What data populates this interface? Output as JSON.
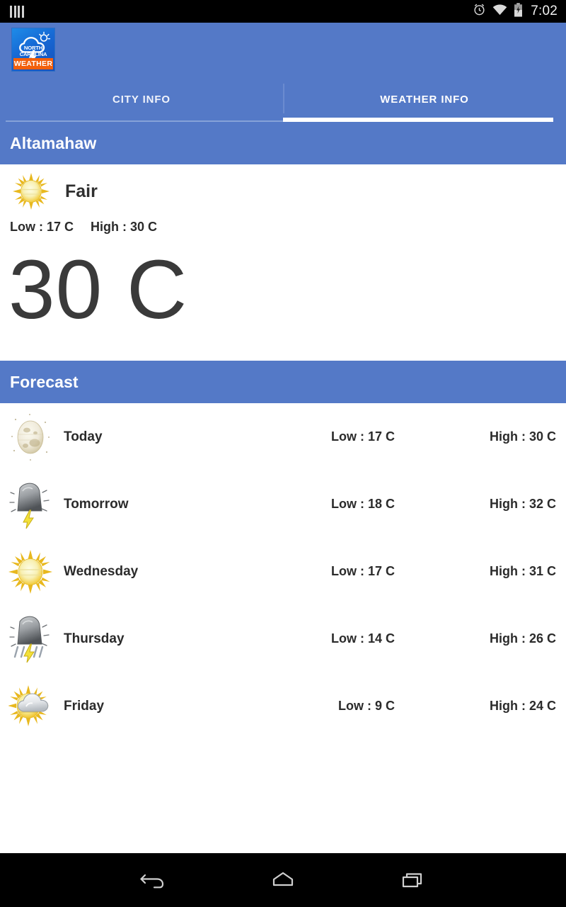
{
  "status_bar": {
    "left_icon": "vertical-bars-icon",
    "icons": [
      "alarm-clock-icon",
      "wifi-icon",
      "battery-charging-icon"
    ],
    "time": "7:02"
  },
  "app_bar": {
    "logo": {
      "icon": "cloud-lightning-sun-icon",
      "region_label": "NORTH CAROLINA",
      "app_label": "WEATHER"
    },
    "background_color": "#5479c7"
  },
  "tabs": [
    {
      "label": "CITY INFO",
      "active": false
    },
    {
      "label": "WEATHER INFO",
      "active": true
    }
  ],
  "city_header": {
    "title": "Altamahaw"
  },
  "current": {
    "icon": "sun-icon",
    "condition": "Fair",
    "low_label": "Low : 17 C",
    "high_label": "High : 30 C",
    "temperature": "30 C"
  },
  "forecast_header": {
    "title": "Forecast"
  },
  "forecast": [
    {
      "day": "Today",
      "icon": "moon-icon",
      "low": "Low : 17 C",
      "high": "High : 30 C"
    },
    {
      "day": "Tomorrow",
      "icon": "thunderstorm-icon",
      "low": "Low : 18 C",
      "high": "High : 32 C"
    },
    {
      "day": "Wednesday",
      "icon": "sun-icon",
      "low": "Low : 17 C",
      "high": "High : 31 C"
    },
    {
      "day": "Thursday",
      "icon": "thunderstorm-rain-icon",
      "low": "Low : 14 C",
      "high": "High : 26 C"
    },
    {
      "day": "Friday",
      "icon": "sun-behind-cloud-icon",
      "low": "Low : 9 C",
      "high": "High : 24 C"
    }
  ],
  "nav_bar": {
    "buttons": [
      "back-icon",
      "home-icon",
      "recents-icon"
    ]
  },
  "colors": {
    "accent_blue": "#5479c7",
    "orange": "#f2600c",
    "text_dark": "#2b2b2b",
    "status_bar": "#000000"
  }
}
